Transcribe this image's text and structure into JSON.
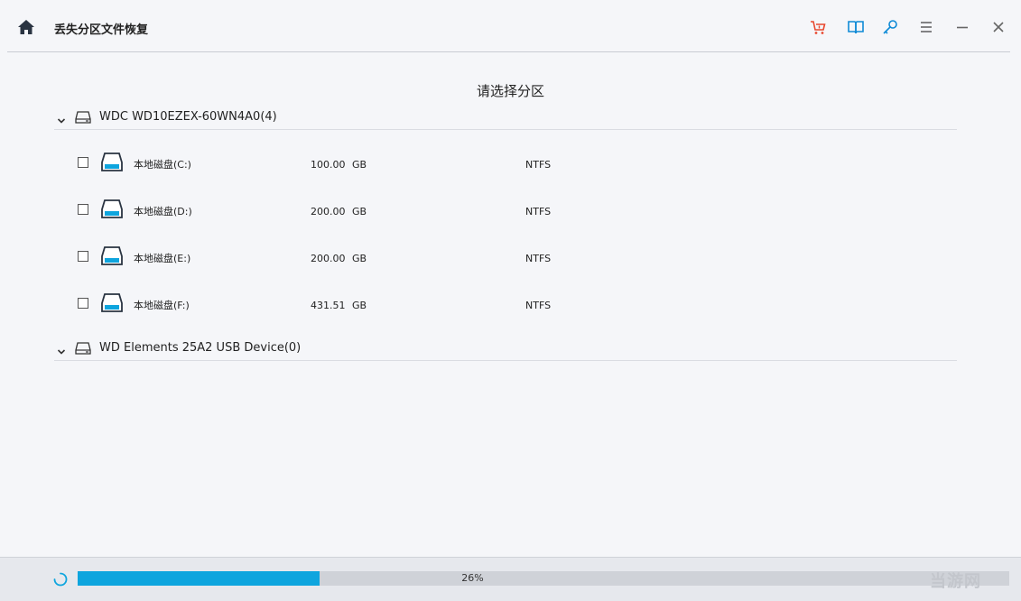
{
  "window": {
    "title": "丢失分区文件恢复",
    "home_icon": "home-icon",
    "toolbar_icons": [
      {
        "name": "cart-icon",
        "color": "#e8482f"
      },
      {
        "name": "book-icon",
        "color": "#0e8ad6"
      },
      {
        "name": "key-icon",
        "color": "#0e8ad6"
      },
      {
        "name": "menu-icon",
        "color": "#666666"
      },
      {
        "name": "minimize-icon",
        "color": "#666666"
      },
      {
        "name": "close-icon",
        "color": "#666666"
      }
    ]
  },
  "main": {
    "heading": "请选择分区",
    "devices": [
      {
        "name": "WDC WD10EZEX-60WN4A0(4)",
        "partitions": [
          {
            "name": "本地磁盘(C:)",
            "size": "100.00",
            "unit": "GB",
            "fs": "NTFS",
            "checked": false
          },
          {
            "name": "本地磁盘(D:)",
            "size": "200.00",
            "unit": "GB",
            "fs": "NTFS",
            "checked": false
          },
          {
            "name": "本地磁盘(E:)",
            "size": "200.00",
            "unit": "GB",
            "fs": "NTFS",
            "checked": false
          },
          {
            "name": "本地磁盘(F:)",
            "size": "431.51",
            "unit": "GB",
            "fs": "NTFS",
            "checked": false
          }
        ]
      },
      {
        "name": "WD Elements 25A2 USB Device(0)",
        "partitions": []
      }
    ]
  },
  "footer": {
    "progress_label": "26%",
    "progress_value": 0.26,
    "watermark": "当游网"
  },
  "colors": {
    "accent": "#0ea5de",
    "background": "#f5f6f9",
    "cart": "#e8482f",
    "icon_blue": "#0e8ad6"
  }
}
